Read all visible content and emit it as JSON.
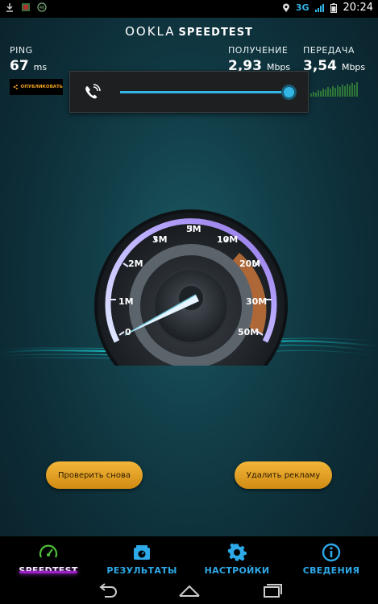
{
  "status_bar": {
    "time": "20:24",
    "network": "3G",
    "icons": [
      "download-icon",
      "app-icon",
      "badge-icon",
      "location-icon",
      "signal-icon",
      "battery-icon"
    ]
  },
  "header": {
    "brand_ookla": "OOKLA",
    "brand_speedtest": "SPEEDTEST"
  },
  "metrics": {
    "ping_label": "PING",
    "ping_value": "67",
    "ping_unit": "ms",
    "download_label": "ПОЛУЧЕНИЕ",
    "download_value": "2,93",
    "download_unit": "Mbps",
    "upload_label": "ПЕРЕДАЧА",
    "upload_value": "3,54",
    "upload_unit": "Mbps"
  },
  "share": {
    "label": "ОПУБЛИКОВАТЬ"
  },
  "volume_popup": {
    "icon": "phone-volume-icon",
    "level": 1.0
  },
  "gauge": {
    "labels": [
      "0",
      "1M",
      "2M",
      "3M",
      "5M",
      "10M",
      "20M",
      "30M",
      "50M"
    ],
    "needle_value": "0"
  },
  "buttons": {
    "retry": "Проверить снова",
    "remove_ads": "Удалить рекламу"
  },
  "tabs": [
    {
      "label": "SPEEDTEST",
      "icon": "gauge-icon",
      "active": true
    },
    {
      "label": "РЕЗУЛЬТАТЫ",
      "icon": "results-icon",
      "active": false
    },
    {
      "label": "НАСТРОЙКИ",
      "icon": "gear-icon",
      "active": false
    },
    {
      "label": "СВЕДЕНИЯ",
      "icon": "info-icon",
      "active": false
    }
  ],
  "nav": [
    "back-icon",
    "home-icon",
    "recents-icon"
  ],
  "colors": {
    "accent": "#33b5e5",
    "button": "#f0ad2a",
    "tab_active": "#a020c8",
    "tab_label": "#2ea9e8"
  }
}
